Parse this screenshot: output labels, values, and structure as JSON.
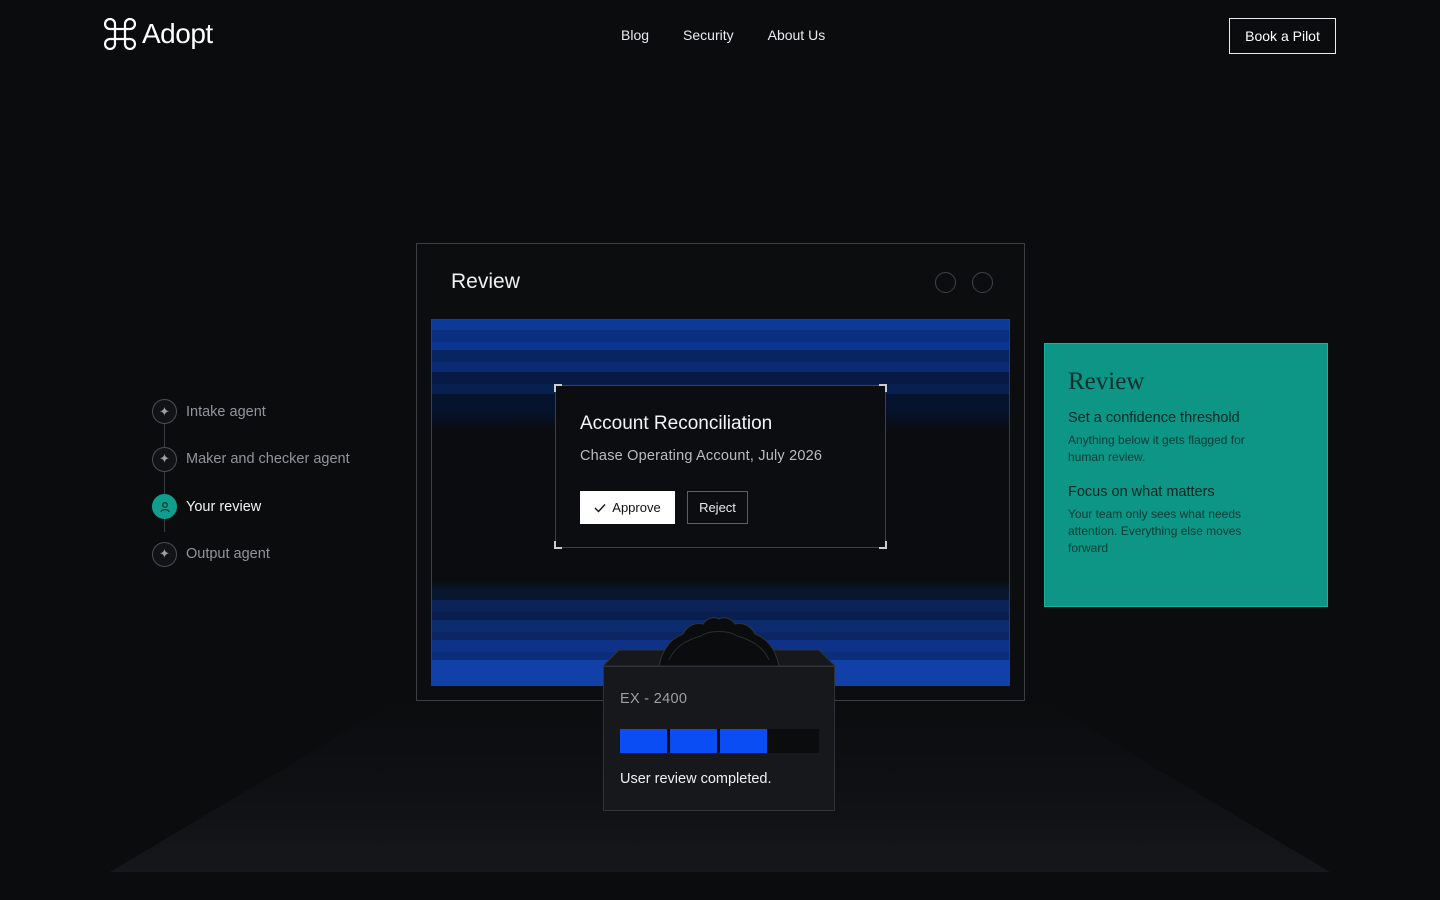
{
  "header": {
    "brand": "Adopt",
    "nav": [
      "Blog",
      "Security",
      "About Us"
    ],
    "cta": "Book a Pilot"
  },
  "steps": [
    {
      "label": "Intake agent",
      "icon": "sparkle-icon",
      "active": false
    },
    {
      "label": "Maker and checker agent",
      "icon": "sparkle-icon",
      "active": false
    },
    {
      "label": "Your review",
      "icon": "person-icon",
      "active": true
    },
    {
      "label": "Output agent",
      "icon": "sparkle-icon",
      "active": false
    }
  ],
  "window": {
    "title": "Review",
    "card": {
      "title": "Account Reconciliation",
      "subtitle": "Chase Operating Account, July 2026",
      "approve_label": "Approve",
      "reject_label": "Reject"
    }
  },
  "device": {
    "code": "EX - 2400",
    "progress": {
      "filled_segments": 3,
      "total_segments": 4
    },
    "message": "User review completed."
  },
  "info_panel": {
    "title": "Review",
    "items": [
      {
        "heading": "Set a confidence threshold",
        "body": "Anything below it gets flagged for human review."
      },
      {
        "heading": "Focus on what matters",
        "body": "Your team only sees what needs attention. Everything else moves forward"
      }
    ]
  },
  "colors": {
    "background": "#0b0c0e",
    "accent_teal": "#0d9586",
    "progress_blue": "#0b4df5"
  }
}
